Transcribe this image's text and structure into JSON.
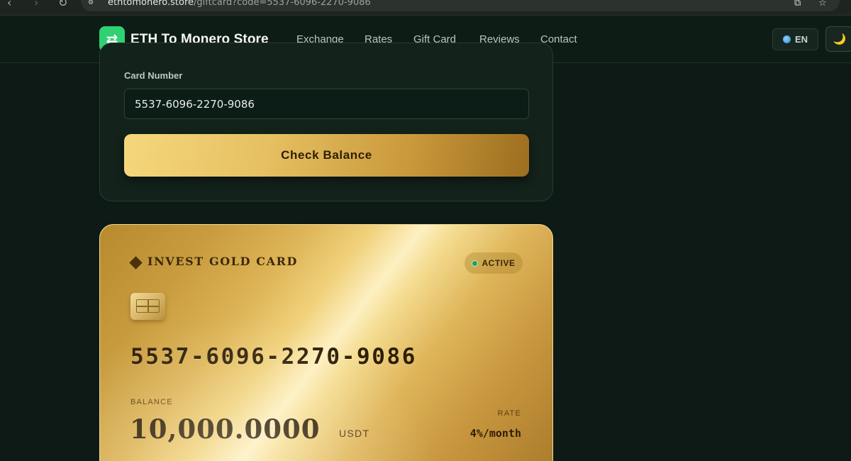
{
  "browser": {
    "url_host": "ethtomonero.store",
    "url_path": "/giftcard?code=5537-6096-2270-9086",
    "back_icon": "chevron-left-icon",
    "forward_icon": "chevron-right-icon",
    "reload_icon": "reload-icon"
  },
  "header": {
    "brand": "ETH To Monero Store",
    "logo_glyph": "⇄",
    "nav": [
      "Exchange",
      "Rates",
      "Gift Card",
      "Reviews",
      "Contact"
    ],
    "language": "EN",
    "theme_glyph": "🌙"
  },
  "form": {
    "card_number_label": "Card Number",
    "card_number_value": "5537-6096-2270-9086",
    "check_button_label": "Check Balance"
  },
  "card": {
    "brand": "INVEST GOLD CARD",
    "status": "ACTIVE",
    "number": "5537-6096-2270-9086",
    "balance_label": "BALANCE",
    "balance_value": "10,000.0000",
    "balance_unit": "USDT",
    "rate_label": "RATE",
    "rate_value": "4%/month"
  },
  "colors": {
    "page_bg": "#0d1a15",
    "brand_green": "#2fd173",
    "gold": "#e6c062",
    "status_green": "#1fa451"
  }
}
